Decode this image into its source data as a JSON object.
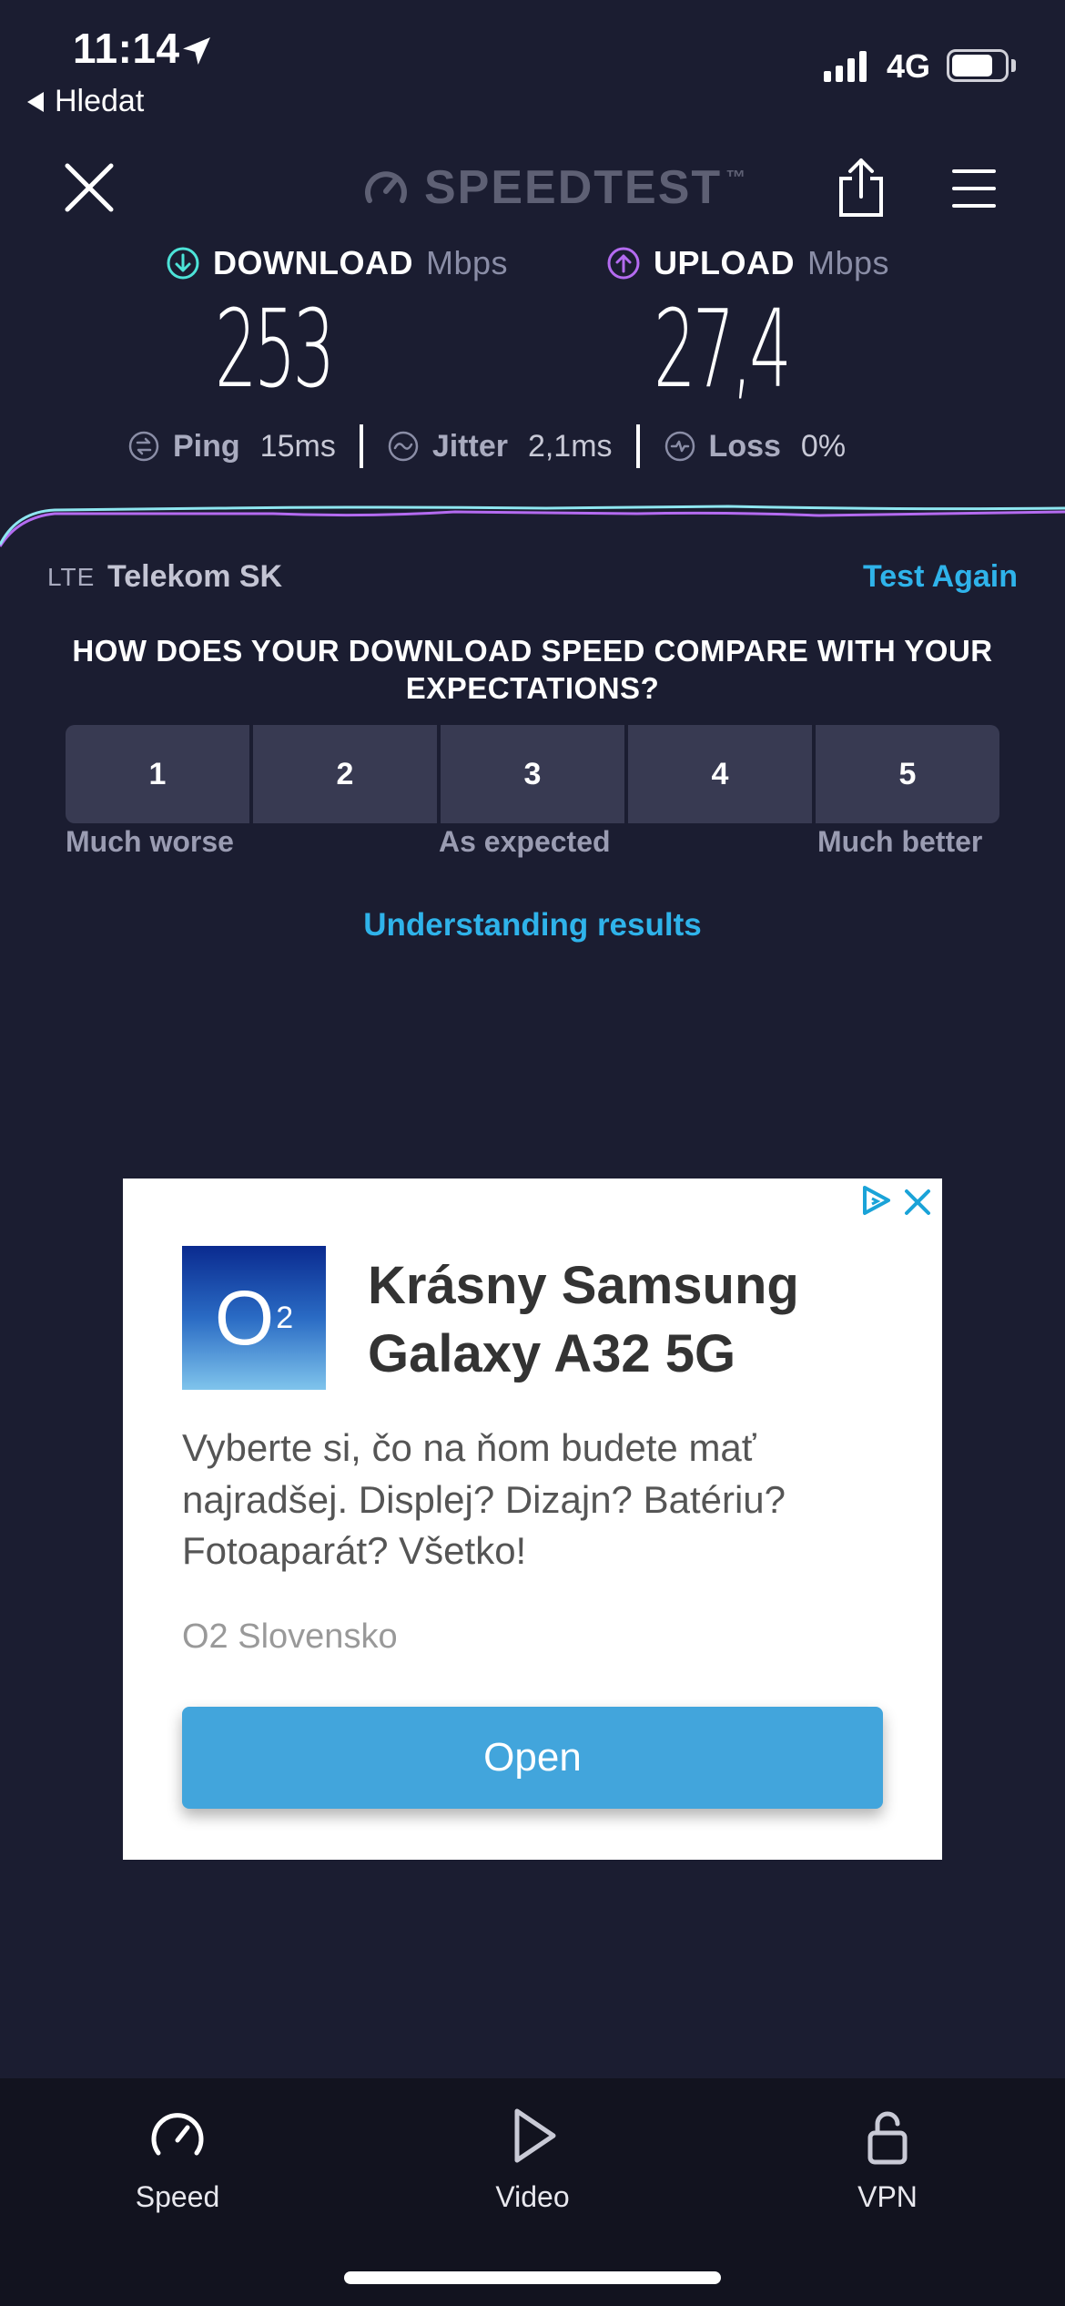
{
  "status_bar": {
    "time": "11:14",
    "back_label": "Hledat",
    "network": "4G",
    "battery_level": 0.78
  },
  "header": {
    "logo_text": "SPEEDTEST",
    "logo_mark": "™"
  },
  "metrics": {
    "download": {
      "label": "DOWNLOAD",
      "unit": "Mbps",
      "value": "253",
      "color": "#4de3d8"
    },
    "upload": {
      "label": "UPLOAD",
      "unit": "Mbps",
      "value": "27,4",
      "color": "#b46bf0"
    },
    "ping": {
      "label": "Ping",
      "value": "15ms"
    },
    "jitter": {
      "label": "Jitter",
      "value": "2,1ms"
    },
    "loss": {
      "label": "Loss",
      "value": "0%"
    }
  },
  "connection": {
    "type": "LTE",
    "carrier": "Telekom SK",
    "test_again_label": "Test Again"
  },
  "rating": {
    "question": "HOW DOES YOUR DOWNLOAD SPEED COMPARE WITH YOUR EXPECTATIONS?",
    "options": [
      "1",
      "2",
      "3",
      "4",
      "5"
    ],
    "low_label": "Much worse",
    "mid_label": "As expected",
    "high_label": "Much better"
  },
  "understanding_label": "Understanding results",
  "ad": {
    "logo_text": "O",
    "logo_sub": "2",
    "title": "Krásny Samsung Galaxy A32 5G",
    "body": "Vyberte si, čo na ňom budete mať najradšej. Displej? Dizajn? Batériu? Fotoaparát? Všetko!",
    "advertiser": "O2 Slovensko",
    "cta": "Open"
  },
  "tabs": [
    {
      "label": "Speed",
      "icon": "speedometer-icon"
    },
    {
      "label": "Video",
      "icon": "play-icon"
    },
    {
      "label": "VPN",
      "icon": "lock-icon"
    }
  ],
  "colors": {
    "background": "#1b1d31",
    "accent": "#2fb3ea",
    "download": "#4de3d8",
    "upload": "#b46bf0"
  }
}
